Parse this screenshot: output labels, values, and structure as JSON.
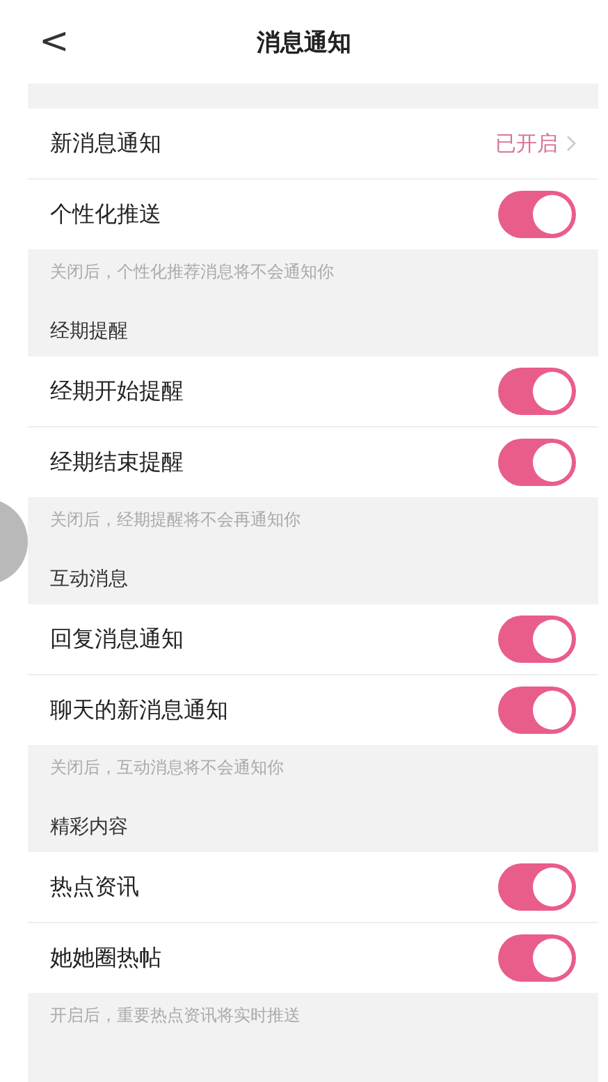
{
  "header": {
    "back": "<",
    "title": "消息通知"
  },
  "sections": [
    {
      "rows": [
        {
          "kind": "link",
          "label": "新消息通知",
          "value": "已开启"
        },
        {
          "kind": "toggle",
          "label": "个性化推送",
          "on": true
        }
      ],
      "footer": "关闭后，个性化推荐消息将不会通知你"
    },
    {
      "title": "经期提醒",
      "rows": [
        {
          "kind": "toggle",
          "label": "经期开始提醒",
          "on": true
        },
        {
          "kind": "toggle",
          "label": "经期结束提醒",
          "on": true
        }
      ],
      "footer": "关闭后，经期提醒将不会再通知你"
    },
    {
      "title": "互动消息",
      "rows": [
        {
          "kind": "toggle",
          "label": "回复消息通知",
          "on": true
        },
        {
          "kind": "toggle",
          "label": "聊天的新消息通知",
          "on": true
        }
      ],
      "footer": "关闭后，互动消息将不会通知你"
    },
    {
      "title": "精彩内容",
      "rows": [
        {
          "kind": "toggle",
          "label": "热点资讯",
          "on": true
        },
        {
          "kind": "toggle",
          "label": "她她圈热帖",
          "on": true
        }
      ],
      "footer": "开启后，重要热点资讯将实时推送"
    }
  ]
}
